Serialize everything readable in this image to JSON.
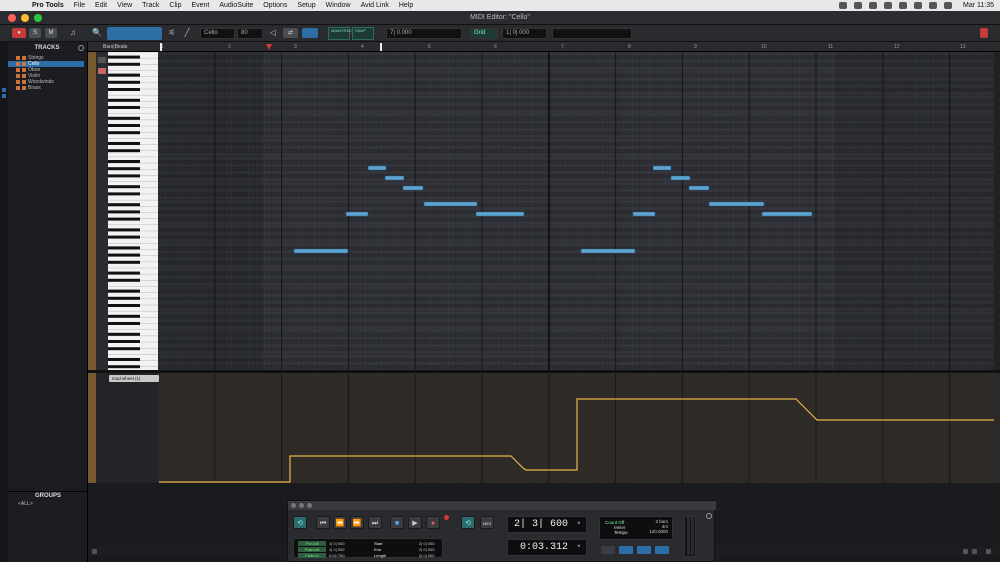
{
  "menubar": {
    "app": "Pro Tools",
    "items": [
      "File",
      "Edit",
      "View",
      "Track",
      "Clip",
      "Event",
      "AudioSuite",
      "Options",
      "Setup",
      "Window",
      "Avid Link",
      "Help"
    ],
    "clock": "Mar 11:35"
  },
  "window": {
    "title": "MIDI Editor: \"Cello\""
  },
  "toolbar": {
    "solo": "S",
    "mute": "M",
    "track_select": "Cello",
    "velocity": "80",
    "grid_value": "Grid",
    "counter_field": "7| 0.000",
    "grid_count": "66",
    "nudge": "1| 0| 000",
    "grid_label_top": "MAINTRACK",
    "grid_label_2": "SNAP"
  },
  "tracks_panel": {
    "header": "TRACKS",
    "items": [
      {
        "name": "Strings",
        "selected": false
      },
      {
        "name": "Cello",
        "selected": true
      },
      {
        "name": "Oboe",
        "selected": false
      },
      {
        "name": "Violin",
        "selected": false
      },
      {
        "name": "Woodwinds",
        "selected": false
      },
      {
        "name": "Brass",
        "selected": false
      }
    ],
    "groups_header": "GROUPS",
    "groups_item": "<ALL>"
  },
  "ruler": {
    "label": "Bars|Beats",
    "bars": [
      "1",
      "2",
      "3",
      "4",
      "5",
      "6",
      "7",
      "8",
      "9",
      "10",
      "11",
      "12",
      "13"
    ]
  },
  "velocity_lane": {
    "selector": "mod wheel (1)"
  },
  "transport": {
    "main_counter": "2| 3| 600",
    "sub_counter": "0:03.312",
    "preroll_label": "Pre-roll",
    "postroll_label": "Post-roll",
    "fadein_label": "Fade-in",
    "preroll_value": "1| 0| 000",
    "postroll_value": "1| 0| 000",
    "fadein_value": "0:02.750",
    "start_label": "Start",
    "end_label": "End",
    "length_label": "Length",
    "start_value": "2| 0| 000",
    "end_value": "2| 0| 000",
    "length_value": "0| 0| 000",
    "count_off": "Count Off",
    "count_bars": "2 bars",
    "meter_label": "Meter",
    "meter_value": "4/4",
    "tempo_label": "Tempo",
    "tempo_value": "120.0000",
    "midi_sync": "MIDI"
  }
}
